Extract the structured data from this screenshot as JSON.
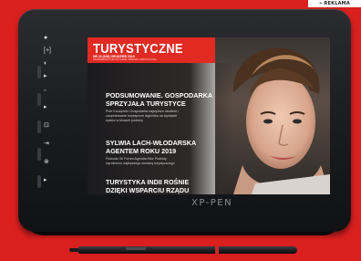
{
  "badge": {
    "label": "» REKLAMA"
  },
  "tablet": {
    "brand": "XP-PEN",
    "hotkeys": [
      "●",
      "[+]",
      "◐",
      "▸",
      "▫",
      "▸",
      "⊡",
      "⇥",
      "⊗",
      "▸"
    ]
  },
  "magazine": {
    "masthead": "TURYSTYCZNE",
    "issue": "NR 22 (636) GRUDZIEŃ 2019",
    "tagline": "WIADOMOŚCI TURYSTYCZNE • BRANŻA TURYSTYCZNA",
    "articles": [
      {
        "headline": [
          "PODSUMOWANIE. GOSPODARKA",
          "SPRZYJAŁA TURYSTYCE"
        ],
        "sub": [
          "Piotr Kuczyński: Gospodarka najwyższe zaufanie i",
          "zaopiniowanie turystyczne wyjeżdża na wystawie",
          "zyskiw w biurach podróży"
        ]
      },
      {
        "headline": [
          "SYLWIA LACH-WŁODARSKA",
          "AGENTEM ROKU 2019"
        ],
        "sub": [
          "Podczas VII Forum Agentów Biur Podróży",
          "wyróżniono najlepszego doradcę turystycznego"
        ]
      },
      {
        "headline": [
          "TURYSTYKA INDII ROŚNIE",
          "DZIĘKI WSPARCIU RZĄDU"
        ],
        "sub": []
      }
    ]
  }
}
